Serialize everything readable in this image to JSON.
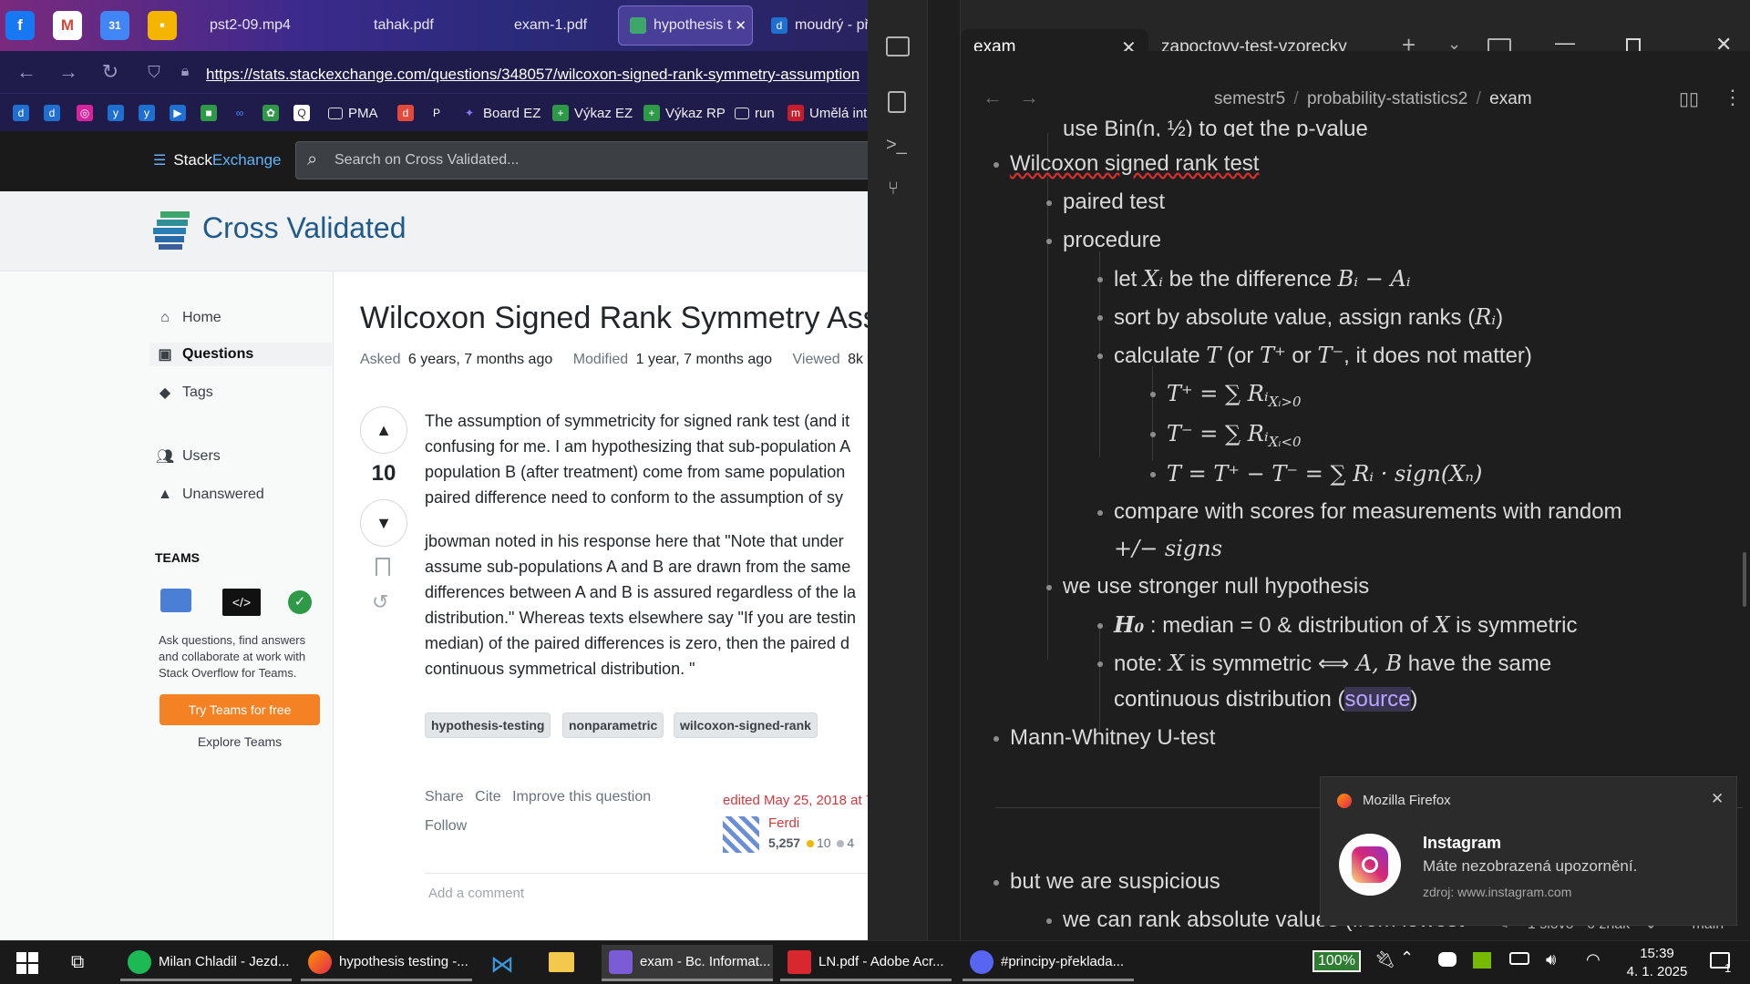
{
  "firefox": {
    "pinned": [
      {
        "name": "facebook-pin-icon",
        "glyph": "f",
        "color": "#1877f2"
      },
      {
        "name": "gmail-pin-icon",
        "glyph": "M",
        "color": "#d44638"
      },
      {
        "name": "calendar-pin-icon",
        "glyph": "31",
        "color": "#4285f4"
      },
      {
        "name": "keep-pin-icon",
        "glyph": "▪",
        "color": "#f4b400"
      }
    ],
    "tabs": [
      "pst2-09.mp4",
      "tahak.pdf",
      "exam-1.pdf",
      "hypothesis t",
      "moudrý - př"
    ],
    "active_tab_index": 3,
    "url": "https://stats.stackexchange.com/questions/348057/wilcoxon-signed-rank-symmetry-assumption",
    "bookmarks": [
      "PMA",
      "Board EZ",
      "Výkaz EZ",
      "Výkaz RP",
      "run",
      "Umělá int"
    ]
  },
  "stackexchange": {
    "logo_stack": "Stack",
    "logo_exchange": "Exchange",
    "search_placeholder": "Search on Cross Validated...",
    "site_name": "Cross Validated",
    "nav": [
      "Home",
      "Questions",
      "Tags",
      "Users",
      "Unanswered"
    ],
    "teams_heading": "TEAMS",
    "teams_text": [
      "Ask questions, find answers",
      "and collaborate at work with",
      "Stack Overflow for Teams."
    ],
    "teams_button": "Try Teams for free",
    "teams_explore": "Explore Teams",
    "question": {
      "title": "Wilcoxon Signed Rank Symmetry Assu",
      "asked_label": "Asked",
      "asked_value": "6 years, 7 months ago",
      "modified_label": "Modified",
      "modified_value": "1 year, 7 months ago",
      "viewed_label": "Viewed",
      "viewed_value": "8k t",
      "votes": "10",
      "para1": [
        "The assumption of symmetricity for signed rank test (and it",
        "confusing for me. I am hypothesizing that sub-population A",
        "population B (after treatment) come from same population",
        "paired difference need to conform to the assumption of sy"
      ],
      "para2": [
        "jbowman noted in his response here that \"Note that under",
        "assume sub-populations A and B are drawn from the same",
        "differences between A and B is assured regardless of the la",
        "distribution.\" Whereas texts elsewhere say \"If you are testin",
        "median) of the paired differences is zero, then the paired d",
        "continuous symmetrical distribution. \""
      ],
      "tags": [
        "hypothesis-testing",
        "nonparametric",
        "wilcoxon-signed-rank"
      ],
      "actions": [
        "Share",
        "Cite",
        "Improve this question"
      ],
      "follow": "Follow",
      "edited": "edited May 25, 2018 at 7",
      "editor": "Ferdi",
      "rep": "5,257",
      "gold": "10",
      "silver": "4",
      "add_comment": "Add a comment"
    }
  },
  "obsidian": {
    "tabs": [
      "exam",
      "zapoctovy-test-vzorecky"
    ],
    "breadcrumb": [
      "semestr5",
      "probability-statistics2",
      "exam"
    ],
    "lines": {
      "l0": "use Bin(n, ½) to get the p-value",
      "l1": "Wilcoxon signed rank test",
      "l2": "paired test",
      "l3": "procedure",
      "l4a": "let ",
      "l4b": "Xᵢ",
      "l4c": " be the difference ",
      "l4d": "Bᵢ − Aᵢ",
      "l5a": "sort by absolute value, assign ranks (",
      "l5b": "Rᵢ",
      "l5c": ")",
      "l6a": "calculate ",
      "l6b": "T",
      "l6c": " (or ",
      "l6d": "T⁺",
      "l6e": " or ",
      "l6f": "T⁻",
      "l6g": ", it does not matter)",
      "l7": "T⁺ = ∑ Rᵢ",
      "l7sub": "Xᵢ>0",
      "l8": "T⁻ = ∑ Rᵢ",
      "l8sub": "Xᵢ<0",
      "l9": "T = T⁺ − T⁻ = ∑ Rᵢ · sign(Xₙ)",
      "l10": "compare with scores for measurements with random",
      "l10b": "+/− signs",
      "l11": "we use stronger null hypothesis",
      "l12a": "H₀",
      "l12b": " : median = 0 & distribution of ",
      "l12c": "X",
      "l12d": " is symmetric",
      "l13a": "note: ",
      "l13b": "X",
      "l13c": " is symmetric ",
      "l13d": "⟺",
      "l13e": " A, B",
      "l13f": " have the same",
      "l13g": "continuous distribution (",
      "l13h": "source",
      "l13i": ")",
      "l14": "Mann-Whitney U-test",
      "l15": "but we are suspicious",
      "l16": "we can rank absolute values (from lowest"
    },
    "status": {
      "words": "1 slovo",
      "chars": "6 znak",
      "branch": "main"
    }
  },
  "notification": {
    "app": "Mozilla Firefox",
    "title": "Instagram",
    "body": "Máte nezobrazená upozornění.",
    "source": "zdroj: www.instagram.com"
  },
  "taskbar": {
    "items": [
      "Milan Chladil - Jezd...",
      "hypothesis testing -...",
      "exam - Bc. Informat...",
      "LN.pdf - Adobe Acr...",
      "#principy-překlada..."
    ],
    "battery": "100%",
    "time": "15:39",
    "date": "4. 1. 2025",
    "notif_count": "1"
  },
  "colors": {
    "obsidian_bg": "#1e1e1e",
    "se_orange": "#f48225",
    "firefox_bar": "#1f1b4a"
  }
}
